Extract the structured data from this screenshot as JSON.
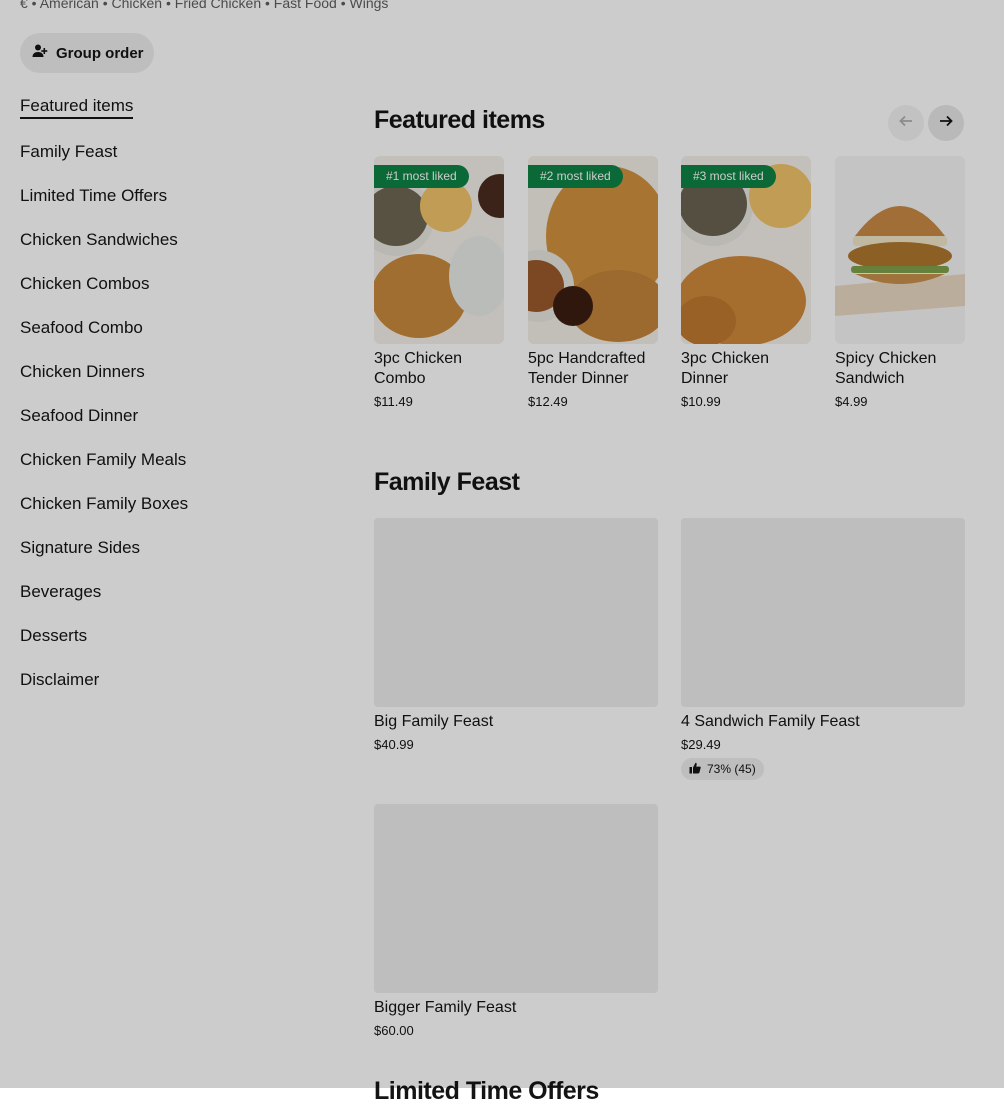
{
  "store": {
    "tags": "€ • American • Chicken • Fried Chicken • Fast Food • Wings",
    "group_order_label": "Group order"
  },
  "sidebar": {
    "items": [
      {
        "label": "Featured items"
      },
      {
        "label": "Family Feast"
      },
      {
        "label": "Limited Time Offers"
      },
      {
        "label": "Chicken Sandwiches"
      },
      {
        "label": "Chicken Combos"
      },
      {
        "label": "Seafood Combo"
      },
      {
        "label": "Chicken Dinners"
      },
      {
        "label": "Seafood Dinner"
      },
      {
        "label": "Chicken Family Meals"
      },
      {
        "label": "Chicken Family Boxes"
      },
      {
        "label": "Signature Sides"
      },
      {
        "label": "Beverages"
      },
      {
        "label": "Desserts"
      },
      {
        "label": "Disclaimer"
      }
    ]
  },
  "featured": {
    "title": "Featured items",
    "items": [
      {
        "badge": "#1 most liked",
        "name": "3pc Chicken Combo",
        "price": "$11.49"
      },
      {
        "badge": "#2 most liked",
        "name": "5pc Handcrafted Tender Dinner",
        "price": "$12.49"
      },
      {
        "badge": "#3 most liked",
        "name": "3pc Chicken Dinner",
        "price": "$10.99"
      },
      {
        "badge": "",
        "name": "Spicy Chicken Sandwich",
        "price": "$4.99"
      }
    ]
  },
  "family_feast": {
    "title": "Family Feast",
    "items": [
      {
        "name": "Big Family Feast",
        "price": "$40.99"
      },
      {
        "name": "4 Sandwich Family Feast",
        "price": "$29.49",
        "rating": "73% (45)"
      },
      {
        "name": "Bigger Family Feast",
        "price": "$60.00"
      }
    ]
  },
  "next_section": {
    "title": "Limited Time Offers"
  },
  "colors": {
    "badge_green": "#0e8345",
    "overlay": "rgba(0,0,0,0.2)"
  }
}
